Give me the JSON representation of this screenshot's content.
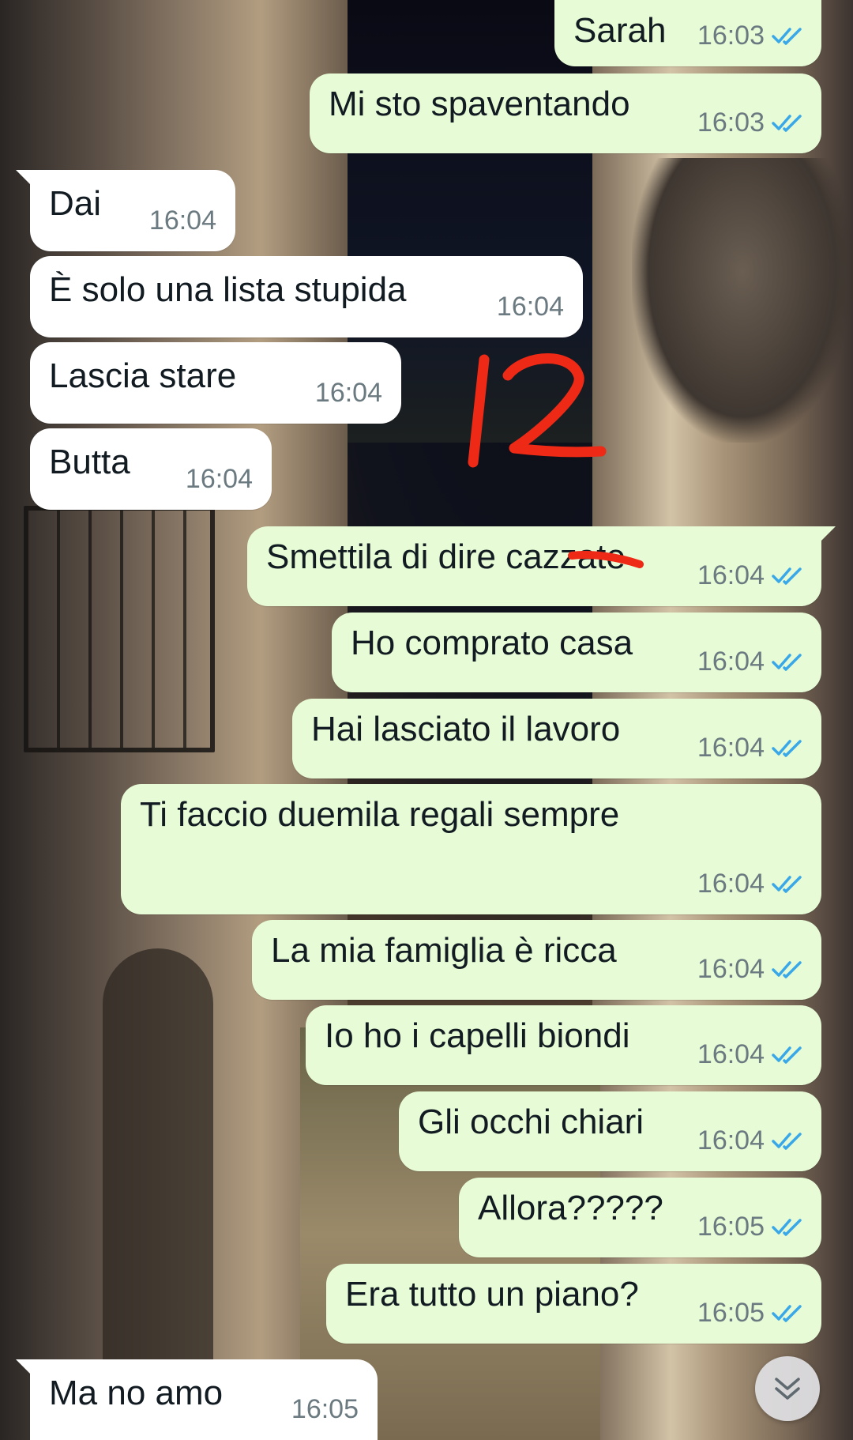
{
  "colors": {
    "outgoing_bubble": "#e7fcd6",
    "incoming_bubble": "#ffffff",
    "read_ticks": "#3aa8e8",
    "timestamp": "#6b7a80",
    "annotation_red": "#ee2a16"
  },
  "annotation": {
    "text": "12"
  },
  "messages": [
    {
      "direction": "outgoing",
      "text": "Sarah",
      "time": "16:03",
      "status": "read"
    },
    {
      "direction": "outgoing",
      "text": "Mi sto spaventando",
      "time": "16:03",
      "status": "read"
    },
    {
      "direction": "incoming",
      "text": "Dai",
      "time": "16:04"
    },
    {
      "direction": "incoming",
      "text": "È solo una lista stupida",
      "time": "16:04"
    },
    {
      "direction": "incoming",
      "text": "Lascia stare",
      "time": "16:04"
    },
    {
      "direction": "incoming",
      "text": "Butta",
      "time": "16:04"
    },
    {
      "direction": "outgoing",
      "text": "Smettila di dire cazzate",
      "time": "16:04",
      "status": "read"
    },
    {
      "direction": "outgoing",
      "text": "Ho comprato casa",
      "time": "16:04",
      "status": "read"
    },
    {
      "direction": "outgoing",
      "text": "Hai lasciato il lavoro",
      "time": "16:04",
      "status": "read"
    },
    {
      "direction": "outgoing",
      "text": "Ti faccio duemila regali sempre",
      "time": "16:04",
      "status": "read"
    },
    {
      "direction": "outgoing",
      "text": "La mia famiglia è ricca",
      "time": "16:04",
      "status": "read"
    },
    {
      "direction": "outgoing",
      "text": "Io ho i capelli biondi",
      "time": "16:04",
      "status": "read"
    },
    {
      "direction": "outgoing",
      "text": "Gli occhi chiari",
      "time": "16:04",
      "status": "read"
    },
    {
      "direction": "outgoing",
      "text": "Allora?????",
      "time": "16:05",
      "status": "read"
    },
    {
      "direction": "outgoing",
      "text": "Era tutto un piano?",
      "time": "16:05",
      "status": "read"
    },
    {
      "direction": "incoming",
      "text": "Ma no amo",
      "time": "16:05"
    }
  ],
  "scroll_button": {
    "icon": "double-chevron-down-icon"
  }
}
